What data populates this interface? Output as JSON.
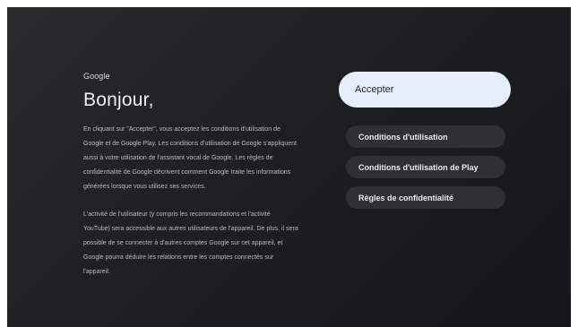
{
  "left": {
    "brand": "Google",
    "title": "Bonjour,",
    "paragraphs": [
      "En cliquant sur \"Accepter\", vous acceptez les conditions d'utilisation de Google et de Google Play. Les conditions d'utilisation de Google s'appliquent aussi à votre utilisation de l'assistant vocal de Google. Les règles de confidentialité de Google décrivent comment Google traite les informations générées lorsque vous utilisez ses services.",
      "L'activité de l'utilisateur (y compris les recommandations et l'activité YouTube) sera accessible aux autres utilisateurs de l'appareil. De plus, il sera possible de se connecter à d'autres comptes Google sur cet appareil, et Google pourra déduire les relations entre les comptes connectés sur l'appareil."
    ]
  },
  "actions": {
    "accept": "Accepter",
    "terms": "Conditions d'utilisation",
    "play_terms": "Conditions d'utilisation de Play",
    "privacy": "Règles de confidentialité"
  }
}
